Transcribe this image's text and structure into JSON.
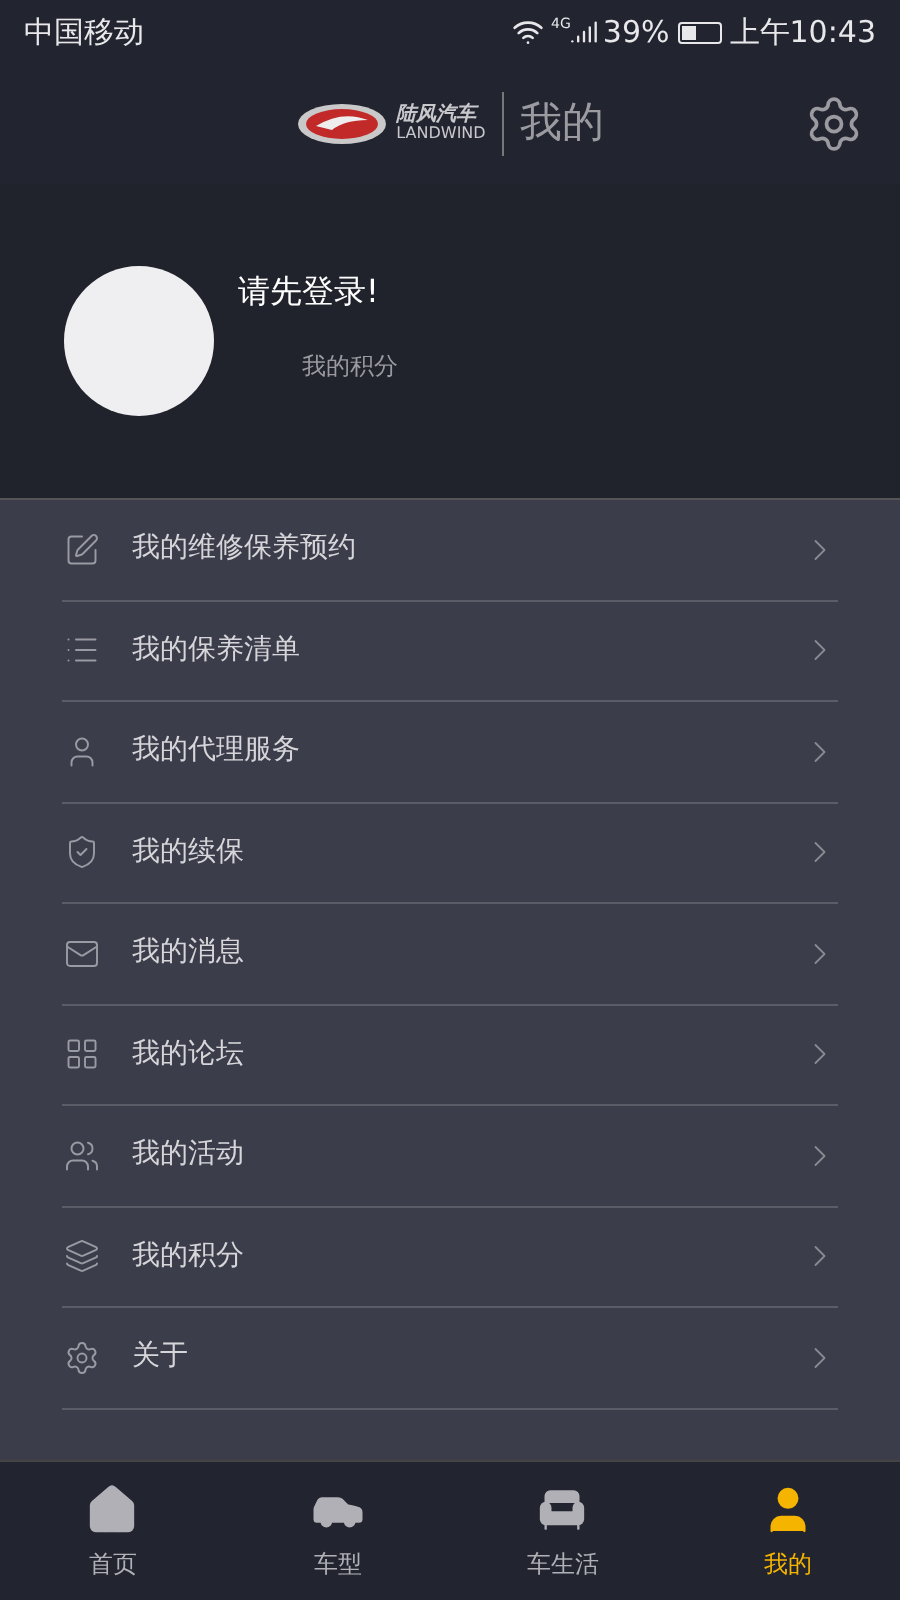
{
  "status_bar": {
    "carrier": "中国移动",
    "network": "4G",
    "battery": "39%",
    "time": "上午10:43"
  },
  "header": {
    "brand_cn": "陆风汽车",
    "brand_en": "LANDWIND",
    "title": "我的"
  },
  "profile": {
    "login_prompt": "请先登录!",
    "points_label": "我的积分"
  },
  "menu": [
    {
      "kind": "edit",
      "label": "我的维修保养预约"
    },
    {
      "kind": "list",
      "label": "我的保养清单"
    },
    {
      "kind": "person",
      "label": "我的代理服务"
    },
    {
      "kind": "shield",
      "label": "我的续保"
    },
    {
      "kind": "mail",
      "label": "我的消息"
    },
    {
      "kind": "grid",
      "label": "我的论坛"
    },
    {
      "kind": "group",
      "label": "我的活动"
    },
    {
      "kind": "stack",
      "label": "我的积分"
    },
    {
      "kind": "gear",
      "label": "关于"
    }
  ],
  "tab_bar": [
    {
      "kind": "home",
      "label": "首页",
      "selected": false
    },
    {
      "kind": "car",
      "label": "车型",
      "selected": false
    },
    {
      "kind": "seat",
      "label": "车生活",
      "selected": false
    },
    {
      "kind": "person",
      "label": "我的",
      "selected": true
    }
  ]
}
